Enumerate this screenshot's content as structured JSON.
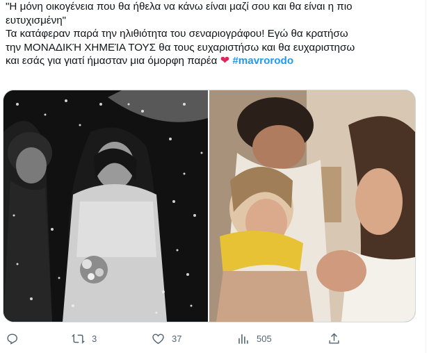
{
  "tweet": {
    "text_line1": "\"Η μόνη οικογένεια που θα ήθελα να κάνω είναι μαζί σου και θα είναι η πιο",
    "text_line2": "ευτυχισμένη\"",
    "text_line3": "Τα κατάφεραν παρά την ηλιθιότητα του σεναριογράφου! Εγώ θα κρατήσω",
    "text_line4": "την ΜΟΝΑΔΙΚΉ ΧΗΜΕΊΑ ΤΟΥΣ θα τους ευχαριστήσω και θα ευχαριστησω",
    "text_line5": "και εσάς για γιατί ήμασταν μια όμορφη παρέα",
    "hashtag": "#mavrorodo",
    "heart": "❤",
    "accent_color": "#1d9bf0"
  },
  "media": {
    "left_alt_icon": "wedding-photo",
    "right_alt_icon": "family-photo"
  },
  "actions": {
    "reply_count": "",
    "retweet_count": "3",
    "like_count": "37",
    "views_count": "505"
  }
}
